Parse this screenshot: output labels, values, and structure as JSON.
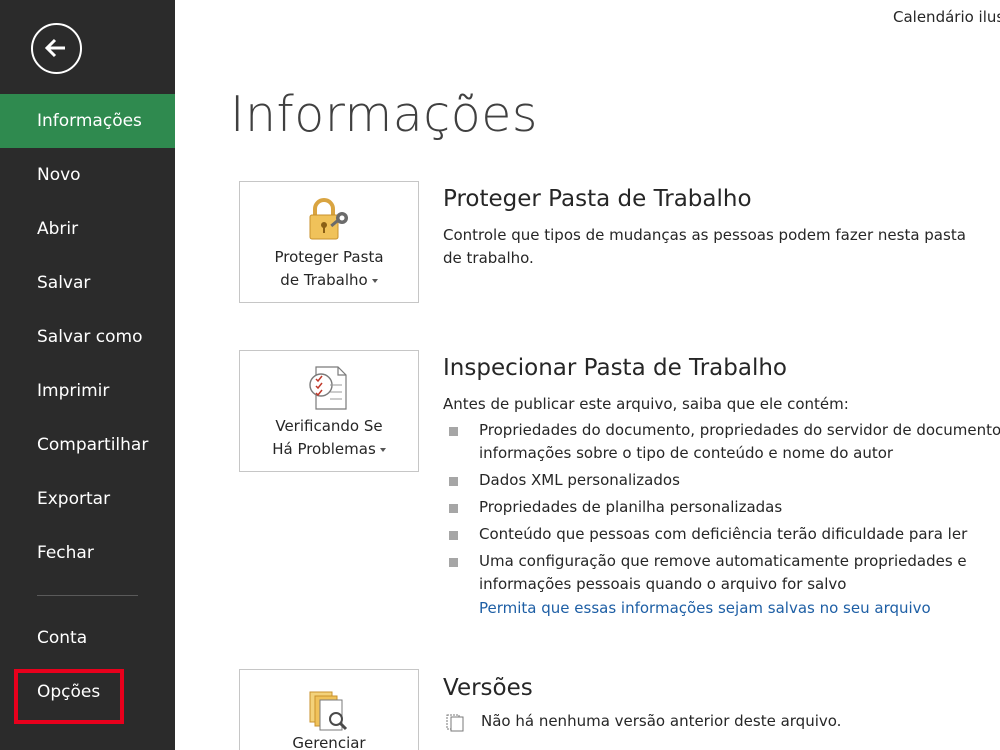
{
  "window": {
    "doc_title": "Calendário ilus"
  },
  "sidebar": {
    "back_icon": "back-arrow-icon",
    "items": [
      {
        "label": "Informações",
        "active": true
      },
      {
        "label": "Novo"
      },
      {
        "label": "Abrir"
      },
      {
        "label": "Salvar"
      },
      {
        "label": "Salvar como"
      },
      {
        "label": "Imprimir"
      },
      {
        "label": "Compartilhar"
      },
      {
        "label": "Exportar"
      },
      {
        "label": "Fechar"
      },
      {
        "label": "Conta"
      },
      {
        "label": "Opções",
        "highlighted": true
      }
    ]
  },
  "main": {
    "title": "Informações",
    "protect": {
      "tile_line1": "Proteger Pasta",
      "tile_line2": "de Trabalho",
      "icon": "lock-key-icon",
      "heading": "Proteger Pasta de Trabalho",
      "description": "Controle que tipos de mudanças as pessoas podem fazer nesta pasta de trabalho."
    },
    "inspect": {
      "tile_line1": "Verificando Se",
      "tile_line2": "Há Problemas",
      "icon": "checklist-icon",
      "heading": "Inspecionar Pasta de Trabalho",
      "intro": "Antes de publicar este arquivo, saiba que ele contém:",
      "bullets": [
        {
          "line1": "Propriedades do documento, propriedades do servidor de documento",
          "line2": "informações sobre o tipo de conteúdo e nome do autor"
        },
        {
          "line1": "Dados XML personalizados"
        },
        {
          "line1": "Propriedades de planilha personalizadas"
        },
        {
          "line1": "Conteúdo que pessoas com deficiência terão dificuldade para ler"
        },
        {
          "line1": "Uma configuração que remove automaticamente propriedades e",
          "line2": "informações pessoais quando o arquivo for salvo"
        }
      ],
      "link": "Permita que essas informações sejam salvas no seu arquivo"
    },
    "versions": {
      "tile_line1": "Gerenciar",
      "icon": "versions-icon",
      "heading": "Versões",
      "status": "Não há nenhuma versão anterior deste arquivo."
    }
  },
  "colors": {
    "sidebar_bg": "#2b2b2b",
    "active_item": "#2f8a4f",
    "highlight_box": "#e8001c",
    "link": "#1e5fa5"
  }
}
